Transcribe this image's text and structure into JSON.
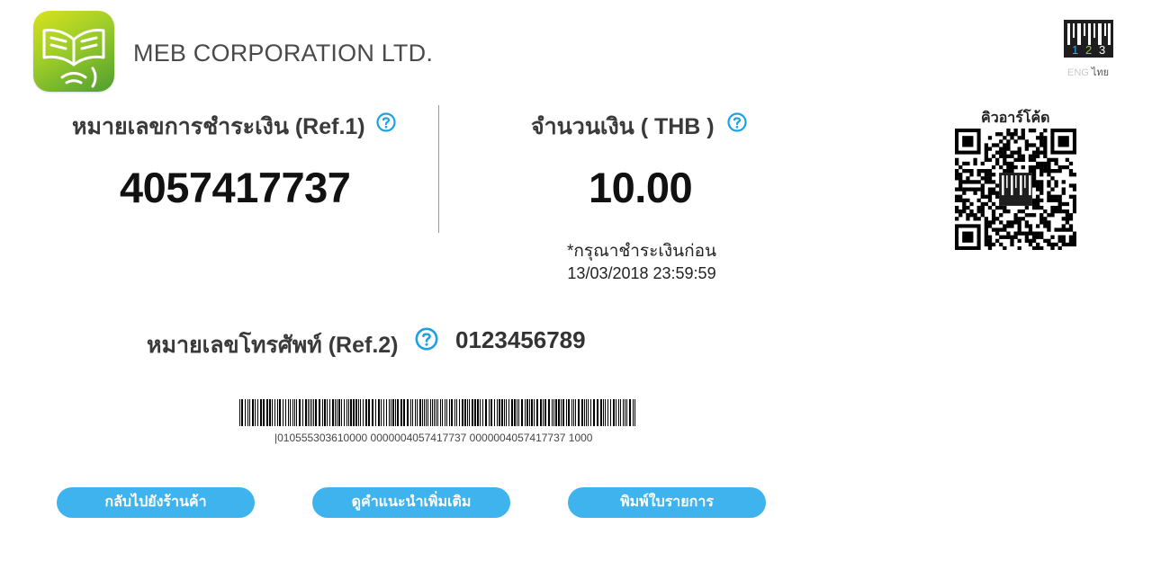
{
  "header": {
    "company_name": "MEB CORPORATION LTD.",
    "service_logo_digits": [
      "1",
      "2",
      "3"
    ],
    "lang": {
      "eng": "ENG",
      "thai": "ไทย"
    }
  },
  "payment": {
    "ref1_label": "หมายเลขการชำระเงิน (Ref.1)",
    "ref1_value": "4057417737",
    "amount_label": "จำนวนเงิน ( THB )",
    "amount_value": "10.00",
    "due_note": "*กรุณาชำระเงินก่อน",
    "due_date": "13/03/2018 23:59:59",
    "ref2_label": "หมายเลขโทรศัพท์ (Ref.2)",
    "ref2_value": "0123456789"
  },
  "qr": {
    "label": "คิวอาร์โค้ด"
  },
  "barcode": {
    "text": "|010555303610000 0000004057417737 0000004057417737 1000"
  },
  "buttons": {
    "back": "กลับไปยังร้านค้า",
    "info": "ดูคำแนะนำเพิ่มเติม",
    "print": "พิมพ์ใบรายการ"
  },
  "colors": {
    "accent": "#3fb3ee",
    "help_icon": "#1da1e2",
    "logo_green": "#9ccc2a"
  },
  "icons": {
    "app_logo": "open-book-icon",
    "help": "question-circle-icon",
    "service_logo": "barcode-123-icon"
  }
}
